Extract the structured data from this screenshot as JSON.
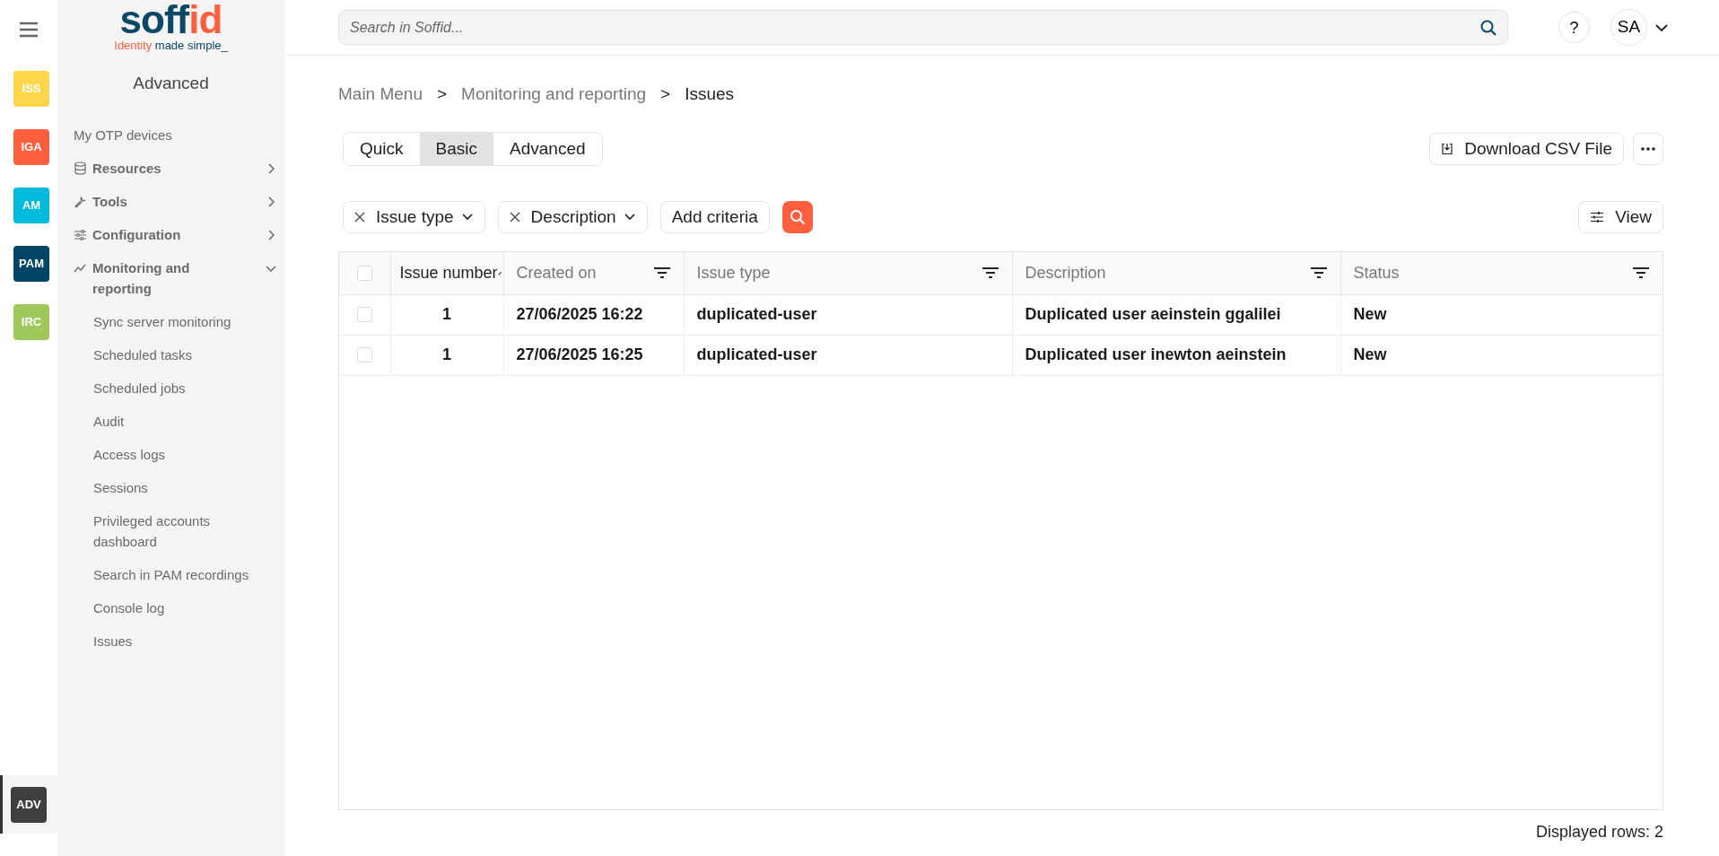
{
  "rail": [
    {
      "label": "ISS",
      "color": "#ffd54a",
      "selected": false
    },
    {
      "label": "IGA",
      "color": "#ff5f3f",
      "selected": false
    },
    {
      "label": "AM",
      "color": "#00bcdc",
      "selected": false
    },
    {
      "label": "PAM",
      "color": "#004466",
      "selected": false
    },
    {
      "label": "IRC",
      "color": "#a0c85a",
      "selected": false
    },
    {
      "label": "ADV",
      "color": "#3f3f3f",
      "selected": true
    }
  ],
  "logo": {
    "word_main": "soff",
    "word_accent": "id",
    "tagline_accent": "Identity",
    "tagline_rest": " made simple_"
  },
  "sidebar": {
    "title": "Advanced",
    "items": [
      {
        "label": "My OTP devices",
        "kind": "link"
      },
      {
        "label": "Resources",
        "kind": "group",
        "expanded": false
      },
      {
        "label": "Tools",
        "kind": "group",
        "expanded": false
      },
      {
        "label": "Configuration",
        "kind": "group",
        "expanded": false
      },
      {
        "label": "Monitoring and reporting",
        "kind": "group",
        "expanded": true,
        "children": [
          {
            "label": "Sync server monitoring"
          },
          {
            "label": "Scheduled tasks"
          },
          {
            "label": "Scheduled jobs"
          },
          {
            "label": "Audit"
          },
          {
            "label": "Access logs"
          },
          {
            "label": "Sessions"
          },
          {
            "label": "Privileged accounts dashboard"
          },
          {
            "label": "Search in PAM recordings"
          },
          {
            "label": "Console log"
          },
          {
            "label": "Issues"
          }
        ]
      }
    ]
  },
  "search": {
    "placeholder": "Search in Soffid..."
  },
  "help": "?",
  "user": {
    "initials": "SA"
  },
  "breadcrumb": [
    "Main Menu",
    "Monitoring and reporting",
    "Issues"
  ],
  "breadcrumb_separator": ">",
  "mode_tabs": [
    {
      "label": "Quick",
      "selected": false
    },
    {
      "label": "Basic",
      "selected": true
    },
    {
      "label": "Advanced",
      "selected": false
    }
  ],
  "download_button": "Download CSV File",
  "criteria": [
    {
      "label": "Issue type"
    },
    {
      "label": "Description"
    }
  ],
  "add_criteria": "Add criteria",
  "view_button": "View",
  "table": {
    "header_checked": false,
    "columns": [
      {
        "label": "Issue number",
        "sorted": true
      },
      {
        "label": "Created on",
        "sorted": false
      },
      {
        "label": "Issue type",
        "sorted": false
      },
      {
        "label": "Description",
        "sorted": false
      },
      {
        "label": "Status",
        "sorted": false
      }
    ],
    "rows": [
      {
        "checked": false,
        "cells": [
          "1",
          "27/06/2025 16:22",
          "duplicated-user",
          "Duplicated user aeinstein ggalilei",
          "New"
        ]
      },
      {
        "checked": false,
        "cells": [
          "1",
          "27/06/2025 16:25",
          "duplicated-user",
          "Duplicated user inewton aeinstein",
          "New"
        ]
      }
    ]
  },
  "footer": "Displayed rows: 2"
}
